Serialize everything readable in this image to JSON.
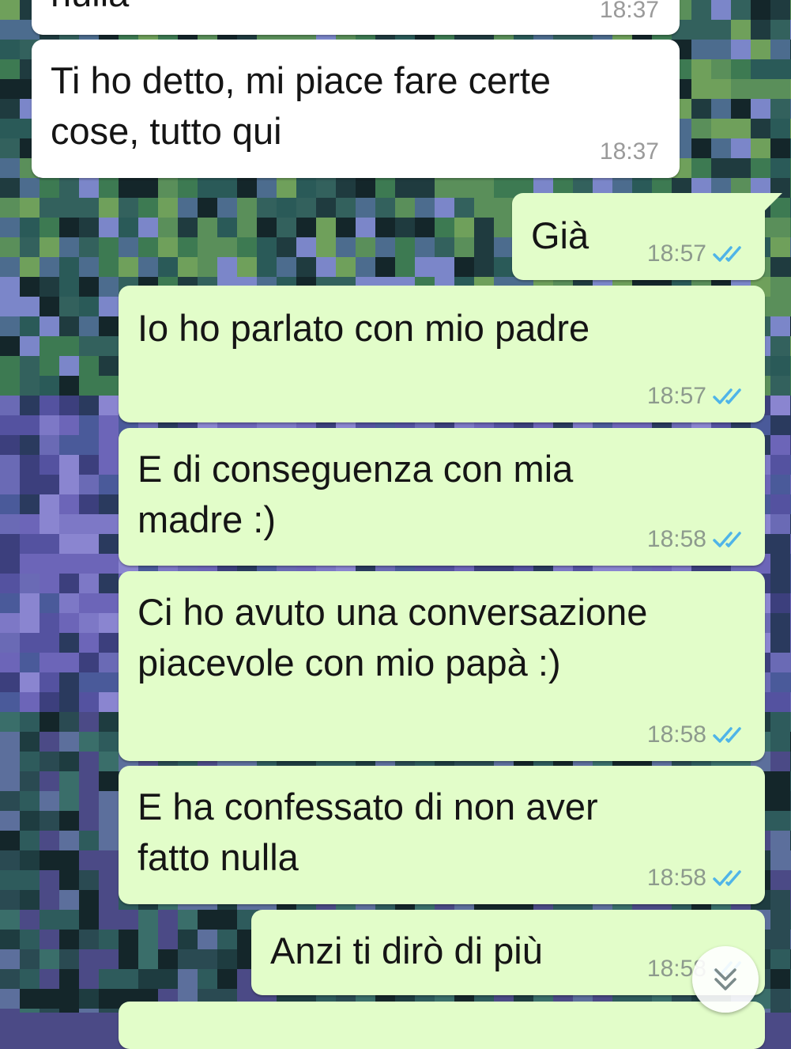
{
  "messages": [
    {
      "id": "m0",
      "direction": "incoming",
      "text_lines": [
        "nulla"
      ],
      "time": "18:37"
    },
    {
      "id": "m1",
      "direction": "incoming",
      "text_lines": [
        "Ti ho detto, mi piace fare certe",
        "cose, tutto qui"
      ],
      "time": "18:37"
    },
    {
      "id": "m2",
      "direction": "outgoing",
      "text_lines": [
        "Già"
      ],
      "time": "18:57",
      "status": "read"
    },
    {
      "id": "m3",
      "direction": "outgoing",
      "text_lines": [
        "Io ho parlato con mio padre"
      ],
      "time": "18:57",
      "status": "read"
    },
    {
      "id": "m4",
      "direction": "outgoing",
      "text_lines": [
        "E di conseguenza con mia",
        "madre :)"
      ],
      "time": "18:58",
      "status": "read"
    },
    {
      "id": "m5",
      "direction": "outgoing",
      "text_lines": [
        "Ci ho avuto una conversazione",
        "piacevole con mio papà :)"
      ],
      "time": "18:58",
      "status": "read"
    },
    {
      "id": "m6",
      "direction": "outgoing",
      "text_lines": [
        "E ha confessato di non aver",
        "fatto nulla"
      ],
      "time": "18:58",
      "status": "read"
    },
    {
      "id": "m7",
      "direction": "outgoing",
      "text_lines": [
        "Anzi ti dirò di più"
      ],
      "time": "18:58",
      "status": "read"
    }
  ],
  "scroll_button": {
    "icon": "double-chevron-down-icon"
  },
  "colors": {
    "incoming_bubble": "#ffffff",
    "outgoing_bubble": "#e2fdc9",
    "read_ticks": "#4fb4e8",
    "timestamp": "#8d9a8d"
  }
}
